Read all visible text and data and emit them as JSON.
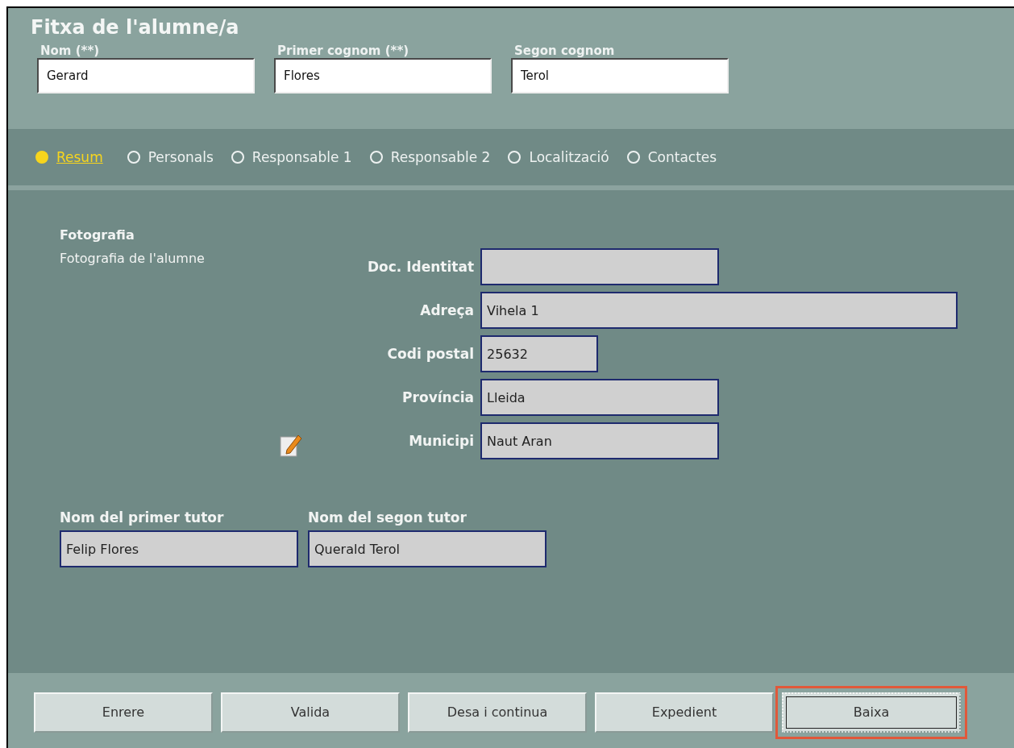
{
  "window": {
    "title": "Fitxa de l'alumne/a"
  },
  "name_fields": [
    {
      "label": "Nom (**)",
      "value": "Gerard"
    },
    {
      "label": "Primer cognom (**)",
      "value": "Flores"
    },
    {
      "label": "Segon cognom",
      "value": "Terol"
    }
  ],
  "tabs": [
    {
      "label": "Resum",
      "selected": true
    },
    {
      "label": "Personals",
      "selected": false
    },
    {
      "label": "Responsable 1",
      "selected": false
    },
    {
      "label": "Responsable 2",
      "selected": false
    },
    {
      "label": "Localització",
      "selected": false
    },
    {
      "label": "Contactes",
      "selected": false
    }
  ],
  "photo": {
    "heading": "Fotografia",
    "caption": "Fotografia de l'alumne"
  },
  "details": [
    {
      "label": "Doc. Identitat",
      "kind": "medium"
    },
    {
      "label": "Adreça",
      "value": "Vihela 1",
      "kind": "long"
    },
    {
      "label": "Codi postal",
      "value": "25632",
      "kind": "short"
    },
    {
      "label": "Província",
      "value": "Lleida",
      "kind": "medium"
    },
    {
      "label": "Municipi",
      "value": "Naut Aran",
      "kind": "medium"
    }
  ],
  "tutors": [
    {
      "label": "Nom del primer tutor",
      "value": "Felip Flores"
    },
    {
      "label": "Nom del segon tutor",
      "value": "Querald Terol"
    }
  ],
  "buttons": [
    {
      "label": "Enrere",
      "highlighted": false
    },
    {
      "label": "Valida",
      "highlighted": false
    },
    {
      "label": "Desa i continua",
      "highlighted": false
    },
    {
      "label": "Expedient",
      "highlighted": false
    },
    {
      "label": "Baixa",
      "highlighted": true
    }
  ]
}
